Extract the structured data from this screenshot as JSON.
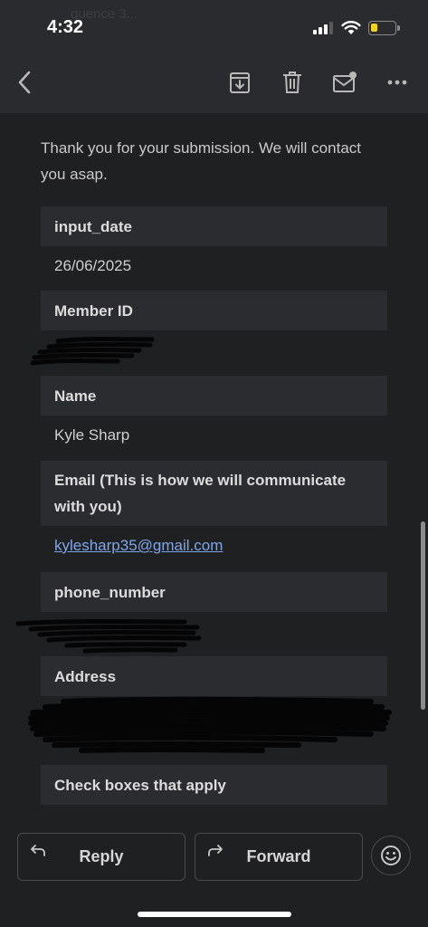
{
  "status_bar": {
    "time": "4:32",
    "ghost_title": "quence 3...",
    "signal_bars": 3,
    "battery_level": 0.2
  },
  "app_bar": {
    "back_icon": "chevron-left-icon",
    "actions": [
      "archive-icon",
      "trash-icon",
      "mark-unread-icon",
      "more-icon"
    ]
  },
  "email": {
    "intro": "Thank you for your submission. We will contact you asap.",
    "fields": [
      {
        "label": "input_date",
        "value": "26/06/2025"
      },
      {
        "label": "Member ID",
        "value": ""
      },
      {
        "label": "Name",
        "value": "Kyle Sharp"
      },
      {
        "label": "Email (This is how we will communicate with you)",
        "value": "kylesharp35@gmail.com"
      },
      {
        "label": "phone_number",
        "value": ""
      },
      {
        "label": "Address",
        "value": ""
      },
      {
        "label": "Check boxes that apply",
        "value": ""
      }
    ]
  },
  "bottom_bar": {
    "reply_label": "Reply",
    "forward_label": "Forward",
    "emoji_icon": "smiley-icon"
  },
  "colors": {
    "background": "#1f2022",
    "header_bg": "#2a2b2e",
    "field_header_bg": "#2b2c2f",
    "link": "#7fa6e8",
    "battery": "#f2d21b"
  }
}
